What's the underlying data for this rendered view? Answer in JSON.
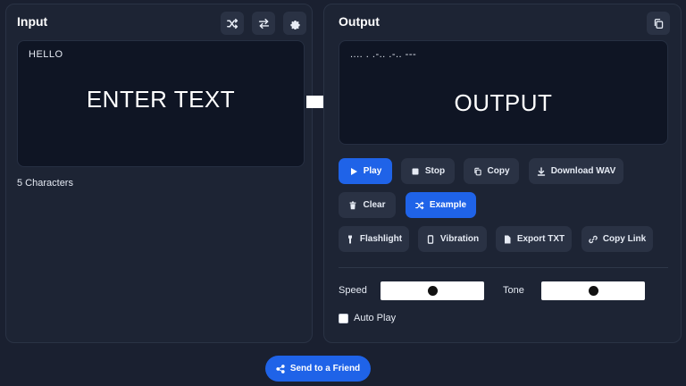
{
  "input": {
    "title": "Input",
    "text": "HELLO",
    "overlay": "ENTER TEXT",
    "char_count": "5 Characters",
    "icons": [
      "shuffle-icon",
      "swap-icon",
      "gear-icon"
    ]
  },
  "output": {
    "title": "Output",
    "morse": ".... . .-.. .-.. ---",
    "overlay": "OUTPUT",
    "icons": [
      "copy-icon"
    ]
  },
  "buttons": {
    "play": "Play",
    "stop": "Stop",
    "copy": "Copy",
    "download": "Download WAV",
    "clear": "Clear",
    "example": "Example",
    "flashlight": "Flashlight",
    "vibration": "Vibration",
    "export": "Export TXT",
    "copy_link": "Copy Link"
  },
  "controls": {
    "speed_label": "Speed",
    "tone_label": "Tone",
    "speed_value": 0.5,
    "tone_value": 0.5,
    "autoplay_label": "Auto Play",
    "autoplay_checked": false
  },
  "footer": {
    "send_label": "Send to a Friend"
  },
  "colors": {
    "background": "#1a2030",
    "panel": "#1d2434",
    "accent": "#1f63e8",
    "button": "#2a3244"
  }
}
